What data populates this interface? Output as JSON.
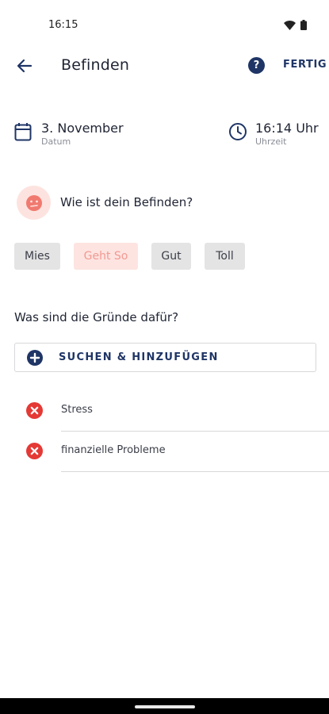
{
  "status_bar": {
    "time": "16:15",
    "icons": [
      "wifi-icon",
      "battery-icon"
    ]
  },
  "app_bar": {
    "back_icon": "arrow-left-icon",
    "title": "Befinden",
    "help_icon": "question-icon",
    "help_glyph": "?",
    "done_label": "FERTIG"
  },
  "date": {
    "icon": "calendar-icon",
    "value": "3. November",
    "label": "Datum"
  },
  "time": {
    "icon": "clock-icon",
    "value": "16:14 Uhr",
    "label": "Uhrzeit"
  },
  "mood": {
    "icon": "mood-face-icon",
    "question": "Wie ist dein Befinden?",
    "options": [
      {
        "label": "Mies",
        "selected": false
      },
      {
        "label": "Geht So",
        "selected": true
      },
      {
        "label": "Gut",
        "selected": false
      },
      {
        "label": "Toll",
        "selected": false
      }
    ]
  },
  "reasons": {
    "question": "Was sind die Gründe dafür?",
    "add_button_label": "SUCHEN & HINZUFÜGEN",
    "items": [
      {
        "label": "Stress",
        "remove_icon": "remove-circle-icon"
      },
      {
        "label": "finanzielle Probleme",
        "remove_icon": "remove-circle-icon"
      }
    ]
  },
  "colors": {
    "primary": "#1f3566",
    "accent_red": "#e53935",
    "chip_selected_bg": "#fde4e1",
    "chip_selected_text": "#f29a92",
    "chip_bg": "#e4e4e4"
  }
}
